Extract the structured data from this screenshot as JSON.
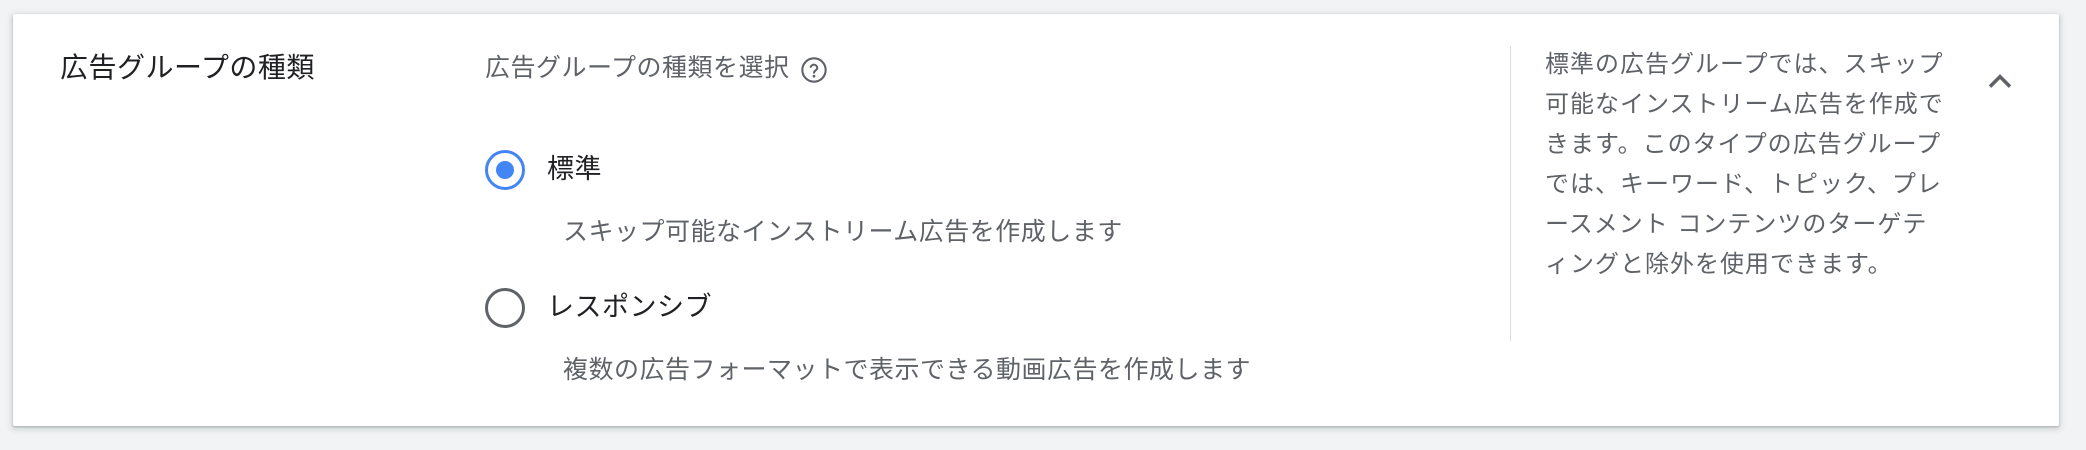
{
  "section": {
    "title": "広告グループの種類"
  },
  "selector": {
    "label": "広告グループの種類を選択",
    "help_icon": "help-circle-icon"
  },
  "options": [
    {
      "label": "標準",
      "description": "スキップ可能なインストリーム広告を作成します",
      "selected": true
    },
    {
      "label": "レスポンシブ",
      "description": "複数の広告フォーマットで表示できる動画広告を作成します",
      "selected": false
    }
  ],
  "help_panel": {
    "text": "標準の広告グループでは、スキップ可能なインストリーム広告を作成できます。このタイプの広告グループでは、キーワード、トピック、プレースメント コンテンツのターゲティングと除外を使用できます。"
  },
  "collapse_icon": "chevron-up-icon",
  "colors": {
    "accent": "#4285f4",
    "text_primary": "#202124",
    "text_secondary": "#5f6368",
    "background": "#f1f3f4",
    "card": "#ffffff"
  }
}
